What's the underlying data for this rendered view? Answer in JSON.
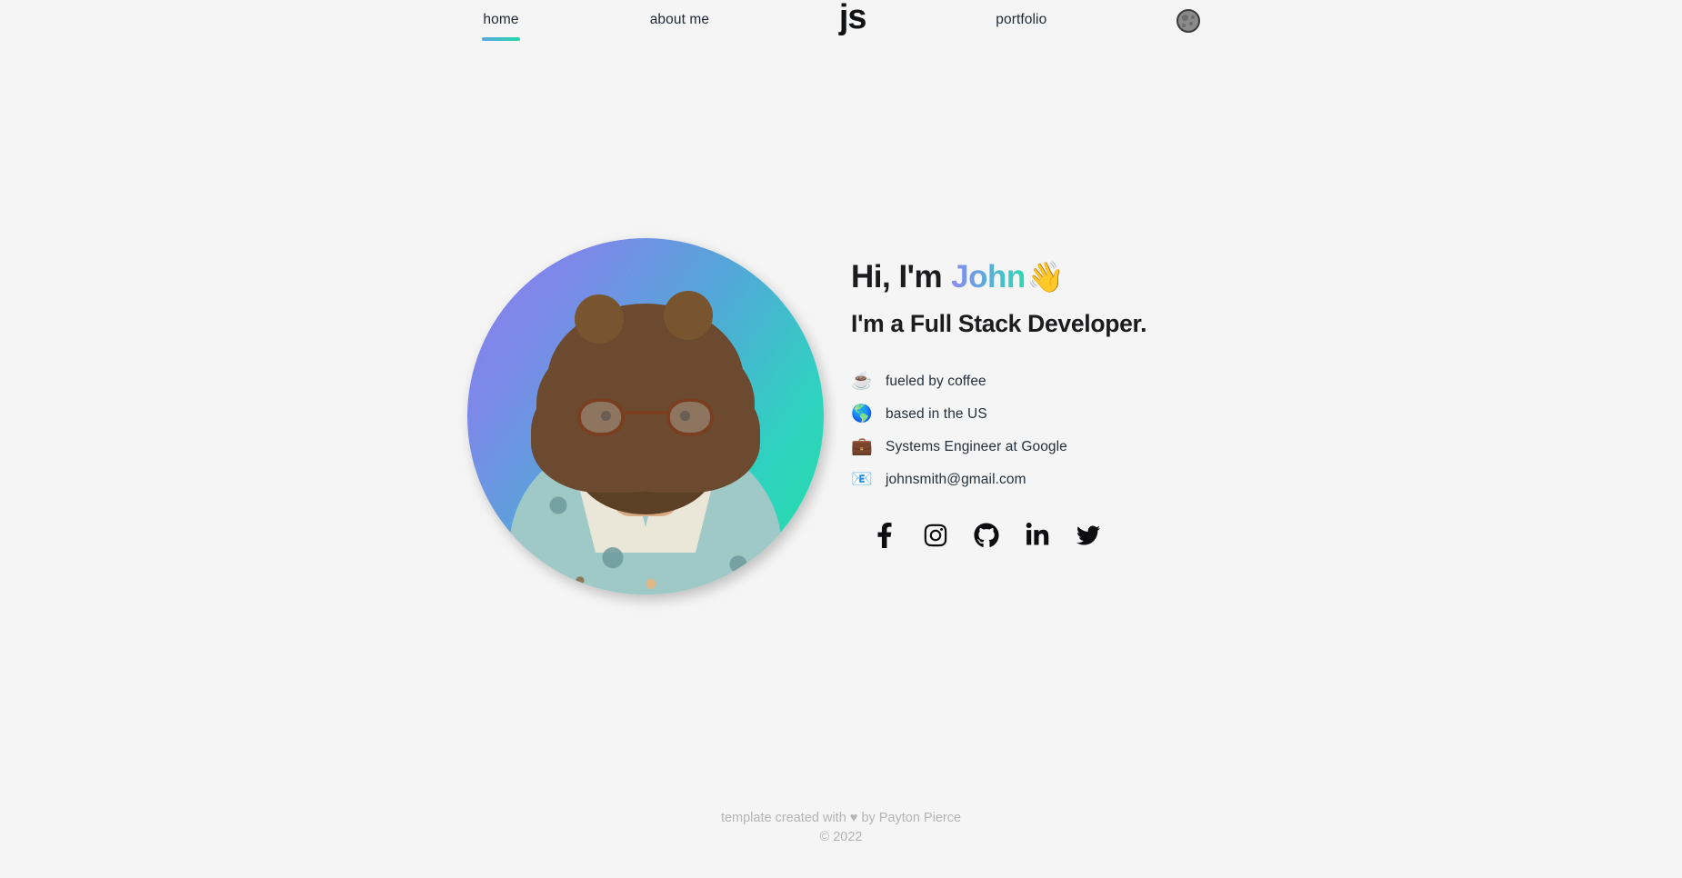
{
  "theme": {
    "background": "#f5f5f5",
    "accent_start": "#8b8bf0",
    "accent_mid": "#5fa8dd",
    "accent_end": "#2ddbb0",
    "text": "#1c1c1e",
    "muted": "#b4b4b4"
  },
  "navbar": {
    "links": [
      {
        "label": "home",
        "active": true
      },
      {
        "label": "about me",
        "active": false
      },
      {
        "label": "portfolio",
        "active": false
      }
    ],
    "logo": "js",
    "theme_toggle": {
      "icon": "moon-icon",
      "title": "toggle dark mode"
    }
  },
  "hero": {
    "avatar": {
      "alt": "portrait of John Smith",
      "gradient_start": "#8b7cf0",
      "gradient_end": "#22dfa4"
    },
    "greeting_prefix": "Hi, I'm",
    "name": "John",
    "wave_emoji": "👋",
    "subheading": "I'm a Full Stack Developer.",
    "info": [
      {
        "emoji": "☕",
        "icon": "coffee-icon",
        "text": "fueled by coffee"
      },
      {
        "emoji": "🌎",
        "icon": "globe-icon",
        "text": "based in the US"
      },
      {
        "emoji": "💼",
        "icon": "briefcase-icon",
        "text": "Systems Engineer at Google"
      },
      {
        "emoji": "📧",
        "icon": "envelope-icon",
        "text": "johnsmith@gmail.com"
      }
    ],
    "socials": [
      {
        "name": "facebook",
        "label": "Facebook"
      },
      {
        "name": "instagram",
        "label": "Instagram"
      },
      {
        "name": "github",
        "label": "GitHub"
      },
      {
        "name": "linkedin",
        "label": "LinkedIn"
      },
      {
        "name": "twitter",
        "label": "Twitter"
      }
    ]
  },
  "footer": {
    "credit_prefix": "template created with",
    "heart": "♥",
    "credit_suffix": "by Payton Pierce",
    "copyright": "© 2022"
  }
}
